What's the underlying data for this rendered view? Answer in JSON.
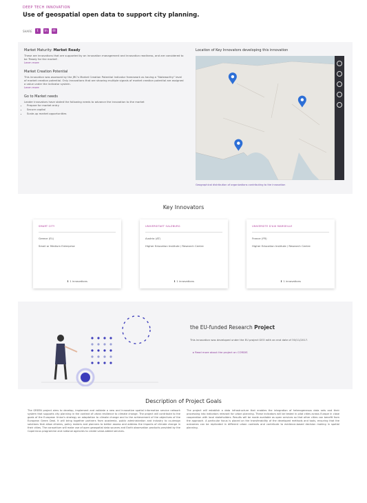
{
  "header": {
    "kicker": "DEEP TECH INNOVATION",
    "title": "Use of geospatial open data to support city planning.",
    "share_label": "SHARE"
  },
  "market": {
    "heading_prefix": "Market Maturity:",
    "heading_value": "Market Ready",
    "text": "These are innovations that are supported by an innovation management and innovation readiness, and are considered to be 'Ready for the market'.",
    "learn_more": "Learn more",
    "creation_heading": "Market Creation Potential",
    "creation_text": "This innovation was assessed by the JRC's Market Creation Potential Indicator framework as having a \"Noteworthy\" level of market creation potential. Only innovations that are showing multiple signals of market creation potential are assigned a value under the indicator system.",
    "creation_link": "Learn more",
    "steps_heading": "Go to Market needs",
    "steps_text": "Leader innovators have stated the following needs to advance the innovation to the market",
    "steps": [
      "Prepare for market entry",
      "Secure capital",
      "Scale-up market opportunities"
    ]
  },
  "map": {
    "label": "Location of Key Innovators developing this innovation",
    "footer": "Geographical distribution of organizations contributing to the innovation",
    "pins": [
      {
        "lat": 50.8,
        "lon": 4.4
      },
      {
        "lat": 48.2,
        "lon": 16.4
      },
      {
        "lat": 43.3,
        "lon": 5.4
      }
    ]
  },
  "innovators": {
    "title": "Key Innovators",
    "cards": [
      {
        "name": "SMART CITY",
        "location": "Greece (EL)",
        "type": "Small or Medium Enterprise",
        "footer": "1 innovations"
      },
      {
        "name": "UNIVERSITAET SALZBURG",
        "location": "Austria (AT)",
        "type": "Higher Education Institute / Research Centre",
        "footer": "1 innovations"
      },
      {
        "name": "UNIVERSITE D'AIX MARSEILLE",
        "location": "France (FR)",
        "type": "Higher Education Institute / Research Centre",
        "footer": "1 innovations"
      }
    ]
  },
  "project": {
    "title_prefix": "the EU-funded Research",
    "title_bold": "Project",
    "text": "This innovation was developed under the EU project GEO with an end date of 30/11/2017.",
    "link": "Read more about the project on CORDIS"
  },
  "description": {
    "title": "Description of Project Goals",
    "col1": "The GREEN project aims to develop, implement and validate a new and innovative spatial information service network system that supports city planning in the context of urban resilience to climate change. The project will contribute to the goals of the European Union's strategy on adaptation to climate change and to the achievement of the objectives of the European Green Deal. It will bring together partners from academia, public administration and industry to co-design solutions that allow citizens, policy makers and planners to better assess and address the impacts of climate change in their cities. The consortium will make use of open geospatial data sources and Earth observation products provided by the Copernicus programme and national agencies to create value-added services.",
    "col2": "The project will establish a data infrastructure that enables the integration of heterogeneous data sets and their processing into indicators relevant for urban planning. These indicators will be tested in pilot cities across Europe in close cooperation with local stakeholders. Results will be made available as open services so that other cities can benefit from the approach. A particular focus is placed on the transferability of the developed methods and tools, ensuring that the outcomes can be replicated in different urban contexts and contribute to evidence-based decision making in spatial planning."
  }
}
